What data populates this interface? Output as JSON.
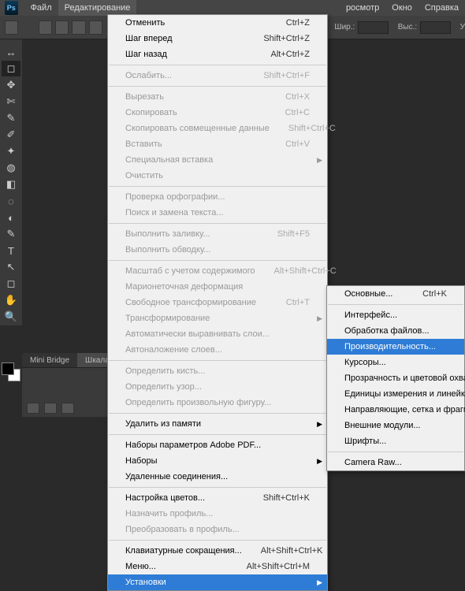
{
  "menubar": {
    "items": [
      "Файл",
      "Редактирование",
      "росмотр",
      "Окно",
      "Справка"
    ]
  },
  "optionsbar": {
    "width_label": "Шир.:",
    "height_label": "Выс.:",
    "unit": "У"
  },
  "panelbar": {
    "tabs": [
      "Mini Bridge",
      "Шкала времени"
    ]
  },
  "editMenu": {
    "g1": [
      {
        "label": "Отменить",
        "sc": "Ctrl+Z"
      },
      {
        "label": "Шаг вперед",
        "sc": "Shift+Ctrl+Z"
      },
      {
        "label": "Шаг назад",
        "sc": "Alt+Ctrl+Z"
      }
    ],
    "g2": [
      {
        "label": "Ослабить...",
        "sc": "Shift+Ctrl+F",
        "disabled": true
      }
    ],
    "g3": [
      {
        "label": "Вырезать",
        "sc": "Ctrl+X",
        "disabled": true
      },
      {
        "label": "Скопировать",
        "sc": "Ctrl+C",
        "disabled": true
      },
      {
        "label": "Скопировать совмещенные данные",
        "sc": "Shift+Ctrl+C",
        "disabled": true
      },
      {
        "label": "Вставить",
        "sc": "Ctrl+V",
        "disabled": true
      },
      {
        "label": "Специальная вставка",
        "sub": true,
        "disabled": true
      },
      {
        "label": "Очистить",
        "disabled": true
      }
    ],
    "g4": [
      {
        "label": "Проверка орфографии...",
        "disabled": true
      },
      {
        "label": "Поиск и замена текста...",
        "disabled": true
      }
    ],
    "g5": [
      {
        "label": "Выполнить заливку...",
        "sc": "Shift+F5",
        "disabled": true
      },
      {
        "label": "Выполнить обводку...",
        "disabled": true
      }
    ],
    "g6": [
      {
        "label": "Масштаб с учетом содержимого",
        "sc": "Alt+Shift+Ctrl+C",
        "disabled": true
      },
      {
        "label": "Марионеточная деформация",
        "disabled": true
      },
      {
        "label": "Свободное трансформирование",
        "sc": "Ctrl+T",
        "disabled": true
      },
      {
        "label": "Трансформирование",
        "sub": true,
        "disabled": true
      },
      {
        "label": "Автоматически выравнивать слои...",
        "disabled": true
      },
      {
        "label": "Автоналожение слоев...",
        "disabled": true
      }
    ],
    "g7": [
      {
        "label": "Определить кисть...",
        "disabled": true
      },
      {
        "label": "Определить узор...",
        "disabled": true
      },
      {
        "label": "Определить произвольную фигуру...",
        "disabled": true
      }
    ],
    "g8": [
      {
        "label": "Удалить из памяти",
        "sub": true
      }
    ],
    "g9": [
      {
        "label": "Наборы параметров Adobe PDF..."
      },
      {
        "label": "Наборы",
        "sub": true
      },
      {
        "label": "Удаленные соединения..."
      }
    ],
    "g10": [
      {
        "label": "Настройка цветов...",
        "sc": "Shift+Ctrl+K"
      },
      {
        "label": "Назначить профиль...",
        "disabled": true
      },
      {
        "label": "Преобразовать в профиль...",
        "disabled": true
      }
    ],
    "g11": [
      {
        "label": "Клавиатурные сокращения...",
        "sc": "Alt+Shift+Ctrl+K"
      },
      {
        "label": "Меню...",
        "sc": "Alt+Shift+Ctrl+M"
      },
      {
        "label": "Установки",
        "sub": true,
        "highlight": true
      }
    ]
  },
  "presetSubmenu": {
    "g1": [
      {
        "label": "Основные...",
        "sc": "Ctrl+K"
      }
    ],
    "g2": [
      {
        "label": "Интерфейс..."
      },
      {
        "label": "Обработка файлов..."
      },
      {
        "label": "Производительность...",
        "highlight": true
      },
      {
        "label": "Курсоры..."
      },
      {
        "label": "Прозрачность и цветовой охват..."
      },
      {
        "label": "Единицы измерения и линейки..."
      },
      {
        "label": "Направляющие, сетка и фрагменты..."
      },
      {
        "label": "Внешние модули..."
      },
      {
        "label": "Шрифты..."
      }
    ],
    "g3": [
      {
        "label": "Camera Raw..."
      }
    ]
  },
  "tools": [
    "↔",
    "◻",
    "✥",
    "✄",
    "✎",
    "✐",
    "✦",
    "◍",
    "◧",
    "◌",
    "◐",
    "✎",
    "T",
    "↖",
    "◻",
    "✋",
    "🔍"
  ]
}
